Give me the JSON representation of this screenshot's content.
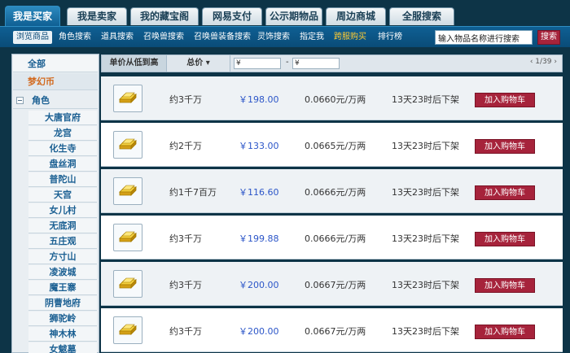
{
  "top_tabs": [
    "我是买家",
    "我是卖家",
    "我的藏宝阁",
    "网易支付",
    "公示期物品",
    "周边商城",
    "全服搜索"
  ],
  "sub_nav": [
    "浏览商品",
    "角色搜索",
    "道具搜索",
    "召唤兽搜索",
    "召唤兽装备搜索",
    "灵饰搜索",
    "指定我",
    "跨服购买",
    "排行榜"
  ],
  "search": {
    "placeholder": "输入物品名称进行搜索",
    "button": "搜索"
  },
  "sidebar": {
    "all": "全部",
    "currency": "梦幻币",
    "role": "角色",
    "servers": [
      "大唐官府",
      "龙宫",
      "化生寺",
      "盘丝洞",
      "普陀山",
      "天宫",
      "女儿村",
      "无底洞",
      "五庄观",
      "方寸山",
      "凌波城",
      "魔王寨",
      "阴曹地府",
      "狮驼岭",
      "神木林",
      "女魃墓"
    ]
  },
  "sort": {
    "unit_price": "单价从低到高",
    "total": "总价",
    "currency_symbol": "¥",
    "dash": "-",
    "page": "1/39"
  },
  "rows": [
    {
      "amount": "约3千万",
      "price": "￥198.00",
      "rate": "0.0660元/万两",
      "time": "13天23时后下架",
      "action": "加入购物车"
    },
    {
      "amount": "约2千万",
      "price": "￥133.00",
      "rate": "0.0665元/万两",
      "time": "13天23时后下架",
      "action": "加入购物车"
    },
    {
      "amount": "约1千7百万",
      "price": "￥116.60",
      "rate": "0.0666元/万两",
      "time": "13天23时后下架",
      "action": "加入购物车"
    },
    {
      "amount": "约3千万",
      "price": "￥199.88",
      "rate": "0.0666元/万两",
      "time": "13天23时后下架",
      "action": "加入购物车"
    },
    {
      "amount": "约3千万",
      "price": "￥200.00",
      "rate": "0.0667元/万两",
      "time": "13天23时后下架",
      "action": "加入购物车"
    },
    {
      "amount": "约3千万",
      "price": "￥200.00",
      "rate": "0.0667元/万两",
      "time": "13天23时后下架",
      "action": "加入购物车"
    }
  ],
  "colors": {
    "background": "#0d3447",
    "accent": "#0f5f93",
    "cart_button": "#a6233b",
    "price": "#2c56c8",
    "hot": "#ffcc33"
  }
}
